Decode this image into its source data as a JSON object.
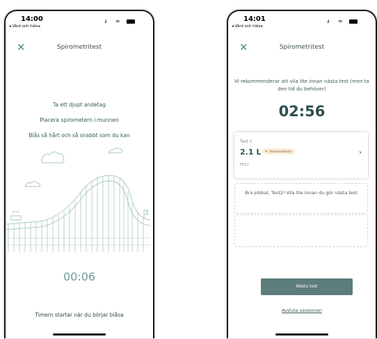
{
  "left_screen": {
    "status": {
      "time": "14:00",
      "back": "◂ Vård och hälsa"
    },
    "nav": {
      "close": "✕",
      "title": "Spirometritest"
    },
    "instructions": [
      "Ta ett djupt andetag",
      "Placera spirometern i munnen",
      "Blås så hårt och så snabbt som du kan"
    ],
    "timer": "00:06",
    "footnote": "Timern startar när du börjar blåsa"
  },
  "right_screen": {
    "status": {
      "time": "14:01",
      "back": "◂ Vård och hälsa"
    },
    "nav": {
      "close": "✕",
      "title": "Spirometritest"
    },
    "rest_message": "Vi rekommenderar att vila lite innan nästa test (men ta den tid du behöver)",
    "countdown": "02:56",
    "test_card": {
      "label": "Test 1",
      "value": "2.1 L",
      "badge": "Sessionsbästa",
      "metric": "FEV1",
      "chevron": "›"
    },
    "feedback": "Bra jobbat, Test2! Vila lite innan du gör nästa test",
    "next_button": "Nästa test",
    "end_link": "Avsluta sessionen"
  },
  "colors": {
    "accent": "#4a8f8d",
    "button": "#5d7c7c",
    "illustration": "#a7c9c6",
    "badge_bg": "#fbeede"
  },
  "icons": {
    "close": "close-icon",
    "chevron": "chevron-right-icon",
    "star": "star-icon",
    "signal": "signal-icon",
    "wifi": "wifi-icon",
    "battery": "battery-icon"
  }
}
